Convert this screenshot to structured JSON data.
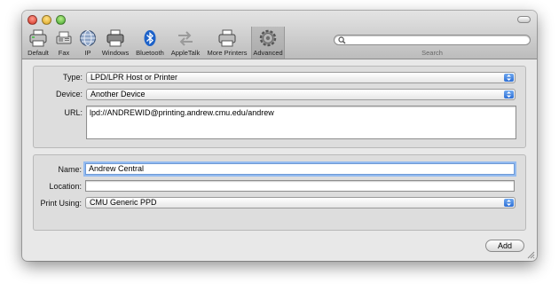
{
  "toolbar": {
    "items": [
      {
        "label": "Default",
        "icon": "printer-icon"
      },
      {
        "label": "Fax",
        "icon": "fax-icon"
      },
      {
        "label": "IP",
        "icon": "globe-icon"
      },
      {
        "label": "Windows",
        "icon": "windows-printer-icon"
      },
      {
        "label": "Bluetooth",
        "icon": "bluetooth-icon"
      },
      {
        "label": "AppleTalk",
        "icon": "appletalk-icon"
      },
      {
        "label": "More Printers",
        "icon": "printer-icon"
      },
      {
        "label": "Advanced",
        "icon": "gear-icon"
      }
    ],
    "search_label": "Search",
    "search_value": ""
  },
  "connection": {
    "type_label": "Type:",
    "type_value": "LPD/LPR Host or Printer",
    "device_label": "Device:",
    "device_value": "Another Device",
    "url_label": "URL:",
    "url_value": "lpd://ANDREWID@printing.andrew.cmu.edu/andrew"
  },
  "printer": {
    "name_label": "Name:",
    "name_value": "Andrew Central",
    "location_label": "Location:",
    "location_value": "",
    "print_using_label": "Print Using:",
    "print_using_value": "CMU Generic PPD"
  },
  "actions": {
    "add_label": "Add"
  },
  "colors": {
    "accent": "#3b7fe0",
    "focus_ring": "#94bbf0",
    "window_bg": "#e8e8e8"
  }
}
